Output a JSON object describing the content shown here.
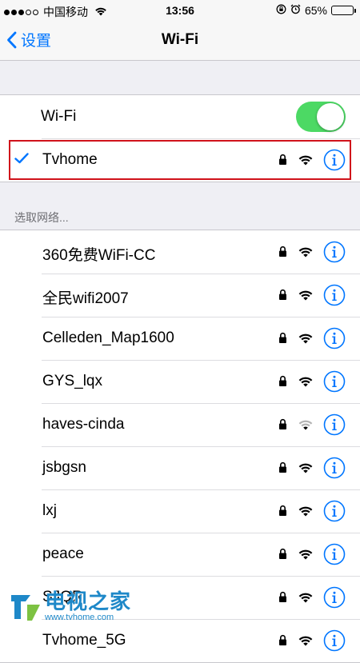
{
  "status_bar": {
    "carrier": "中国移动",
    "time": "13:56",
    "battery_percent": "65%",
    "battery_level": 0.65,
    "signal_bars_filled": 3,
    "signal_bars_total": 5
  },
  "nav": {
    "back_label": "设置",
    "title": "Wi-Fi"
  },
  "wifi_toggle": {
    "label": "Wi-Fi",
    "on": true
  },
  "connected_network": {
    "name": "Tvhome",
    "secured": true,
    "signal": "full"
  },
  "section_header": "选取网络...",
  "networks": [
    {
      "name": "360免费WiFi-CC",
      "secured": true,
      "signal": "full"
    },
    {
      "name": "全民wifi2007",
      "secured": true,
      "signal": "full"
    },
    {
      "name": "Celleden_Map1600",
      "secured": true,
      "signal": "full"
    },
    {
      "name": "GYS_lqx",
      "secured": true,
      "signal": "full"
    },
    {
      "name": "haves-cinda",
      "secured": true,
      "signal": "weak"
    },
    {
      "name": "jsbgsn",
      "secured": true,
      "signal": "full"
    },
    {
      "name": "lxj",
      "secured": true,
      "signal": "full"
    },
    {
      "name": "peace",
      "secured": true,
      "signal": "full"
    },
    {
      "name": "SJQR",
      "secured": true,
      "signal": "full"
    },
    {
      "name": "Tvhome_5G",
      "secured": true,
      "signal": "full"
    }
  ],
  "watermark": {
    "title": "电视之家",
    "url": "www.tvhome.com"
  },
  "colors": {
    "accent": "#0076ff",
    "toggle_on": "#4cd964",
    "highlight_border": "#d0121b"
  },
  "icons": {
    "back": "chevron-left-icon",
    "check": "checkmark-icon",
    "lock": "lock-icon",
    "wifi": "wifi-signal-icon",
    "info": "info-circle-icon"
  }
}
